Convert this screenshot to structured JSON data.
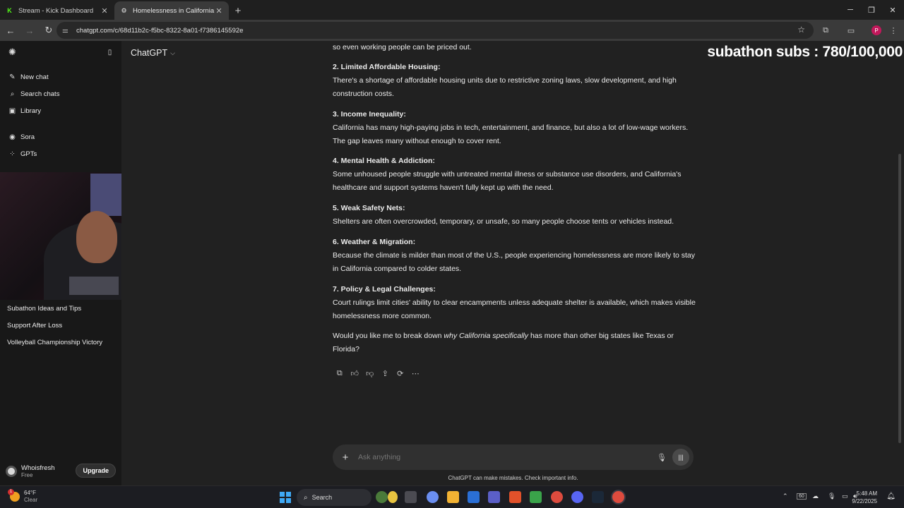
{
  "browser": {
    "tabs": [
      {
        "title": "Stream - Kick Dashboard",
        "icon": "K"
      },
      {
        "title": "Homelessness in California",
        "icon": "⚙"
      }
    ],
    "url": "chatgpt.com/c/68d11b2c-f5bc-8322-8a01-f7386145592e",
    "profile_initial": "P"
  },
  "sidebar": {
    "items": [
      {
        "label": "New chat"
      },
      {
        "label": "Search chats"
      },
      {
        "label": "Library"
      },
      {
        "label": "Sora"
      },
      {
        "label": "GPTs"
      }
    ],
    "chats": [
      "Subathon Ideas and Tips",
      "Support After Loss",
      "Volleyball Championship Victory"
    ],
    "user": {
      "name": "Whoisfresh",
      "plan": "Free",
      "upgrade_label": "Upgrade"
    }
  },
  "header": {
    "model": "ChatGPT",
    "overlay": "subathon subs : 780/100,000"
  },
  "message": {
    "intro_tail": "so even working people can be priced out.",
    "sections": [
      {
        "heading": "2. Limited Affordable Housing:",
        "body": "There's a shortage of affordable housing units due to restrictive zoning laws, slow development, and high construction costs."
      },
      {
        "heading": "3. Income Inequality:",
        "body": "California has many high-paying jobs in tech, entertainment, and finance, but also a lot of low-wage workers. The gap leaves many without enough to cover rent."
      },
      {
        "heading": "4. Mental Health & Addiction:",
        "body": "Some unhoused people struggle with untreated mental illness or substance use disorders, and California's healthcare and support systems haven't fully kept up with the need."
      },
      {
        "heading": "5. Weak Safety Nets:",
        "body": "Shelters are often overcrowded, temporary, or unsafe, so many people choose tents or vehicles instead."
      },
      {
        "heading": "6. Weather & Migration:",
        "body": "Because the climate is milder than most of the U.S., people experiencing homelessness are more likely to stay in California compared to colder states."
      },
      {
        "heading": "7. Policy & Legal Challenges:",
        "body": "Court rulings limit cities' ability to clear encampments unless adequate shelter is available, which makes visible homelessness more common."
      }
    ],
    "closing_pre": "Would you like me to break down ",
    "closing_em": "why California specifically",
    "closing_post": " has more than other big states like Texas or Florida?"
  },
  "composer": {
    "placeholder": "Ask anything",
    "disclaimer": "ChatGPT can make mistakes. Check important info."
  },
  "taskbar": {
    "weather_temp": "64°F",
    "weather_cond": "Clear",
    "weather_badge": "1",
    "search_label": "Search",
    "time": "5:48 AM",
    "date": "9/22/2025",
    "tray_badge": "60"
  },
  "colors": {
    "bg_main": "#212121",
    "bg_sidebar": "#181818",
    "kick_green": "#53fc18",
    "profile": "#c2185b"
  }
}
